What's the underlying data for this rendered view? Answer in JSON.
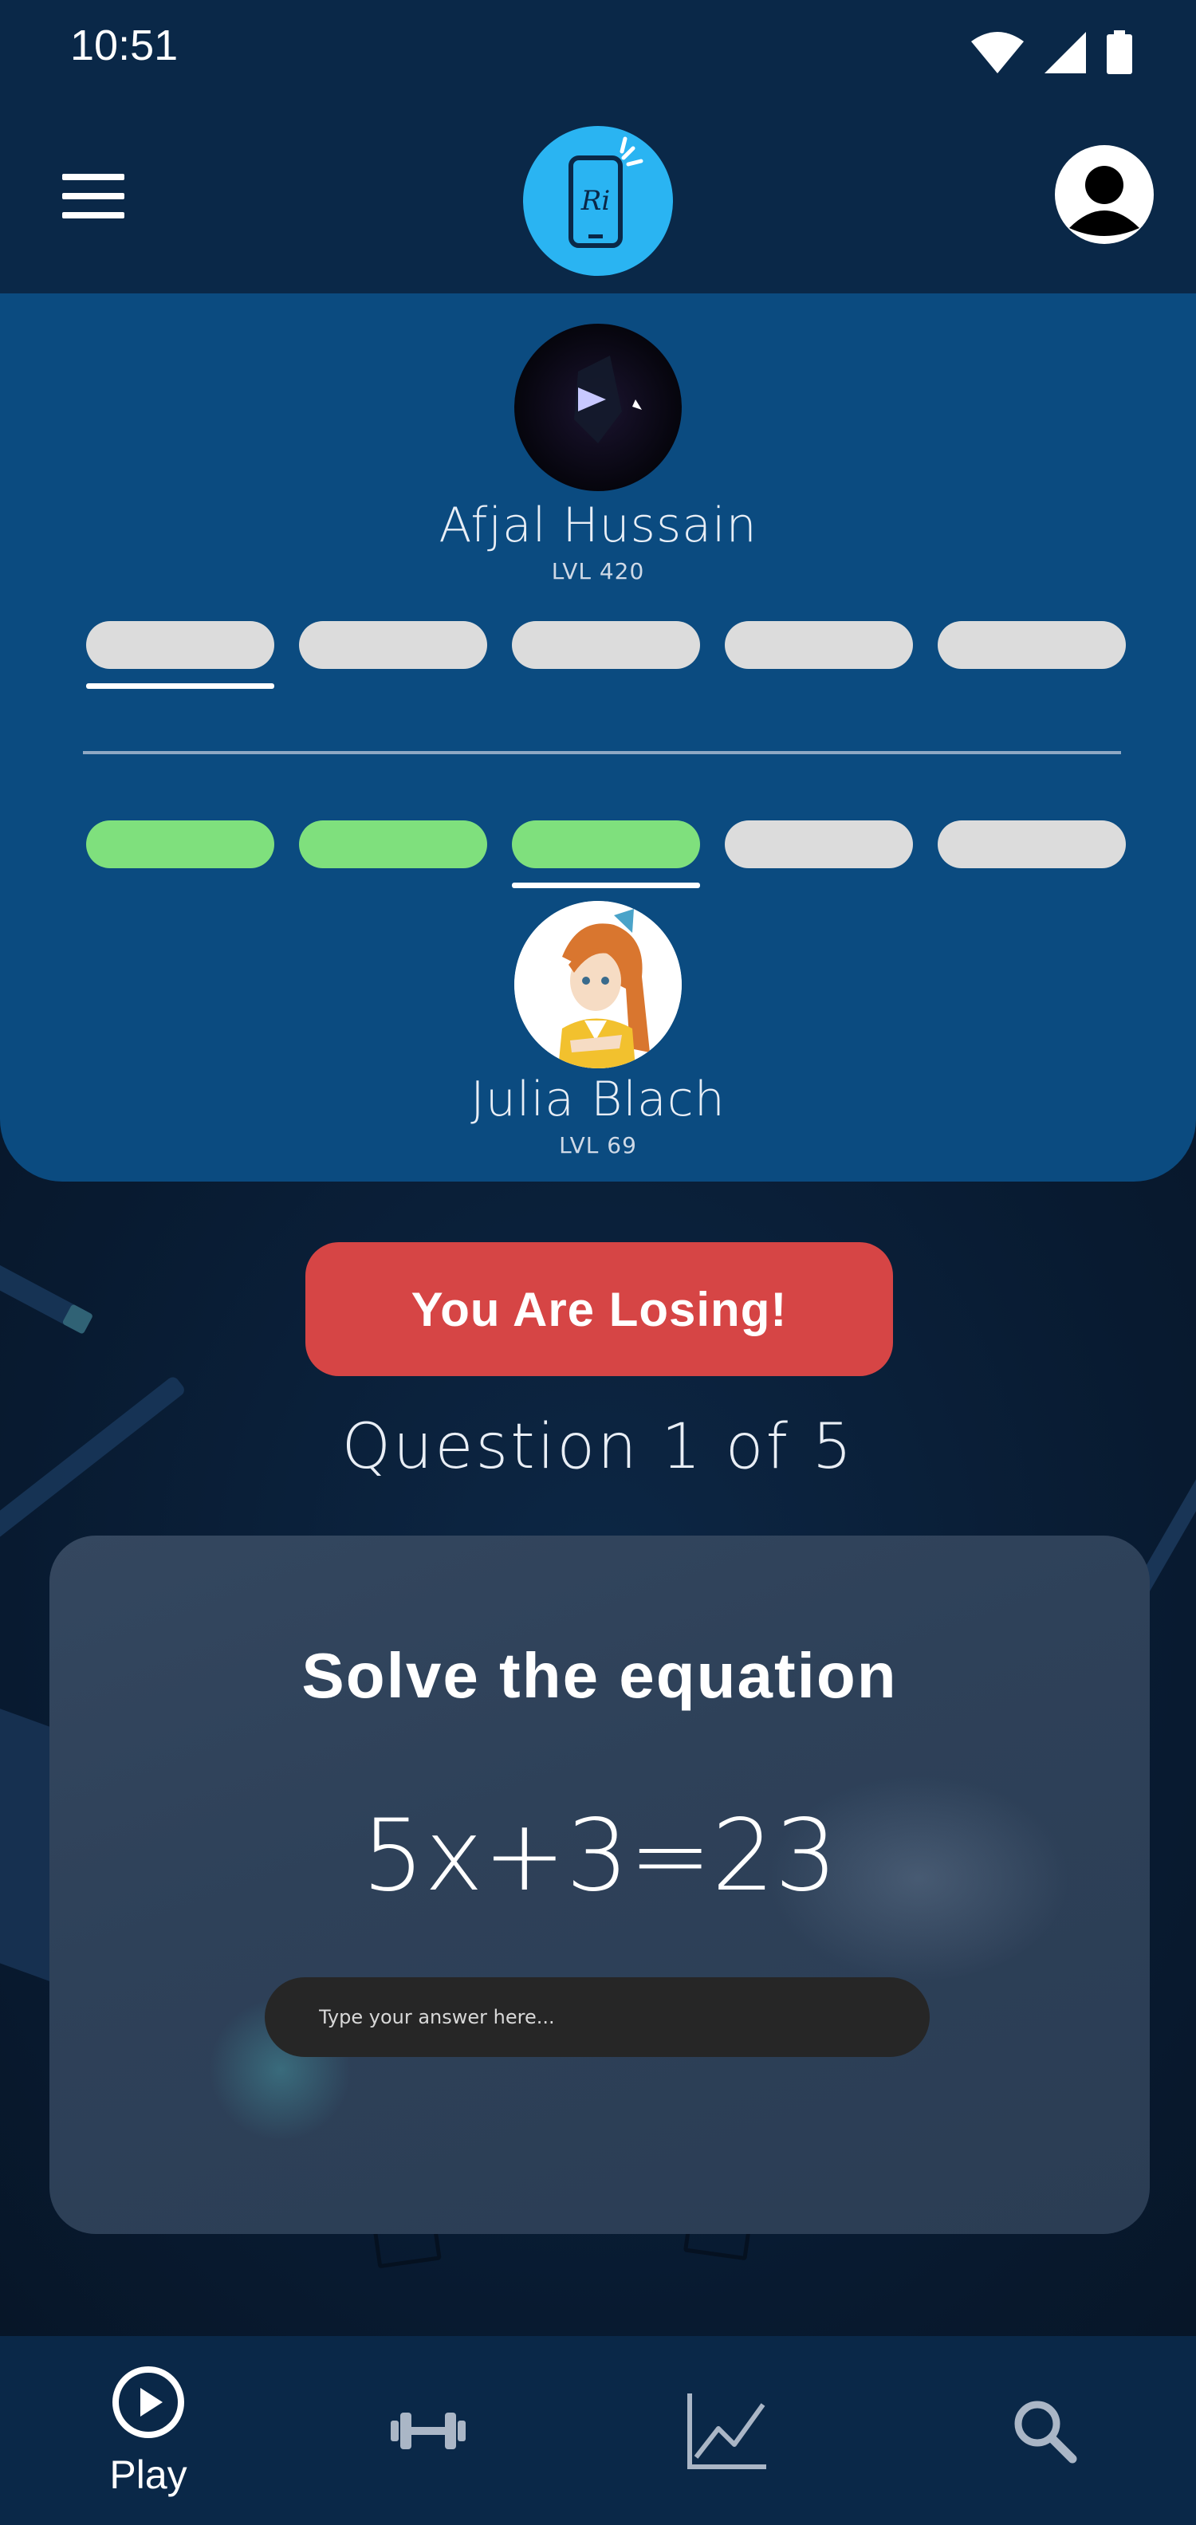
{
  "status_bar": {
    "time": "10:51"
  },
  "app_bar": {
    "logo_icon": "phone-logo-icon",
    "menu_icon": "hamburger-menu-icon",
    "profile_icon": "profile-avatar-icon"
  },
  "match": {
    "opponent": {
      "name": "Afjal Hussain",
      "level": "LVL 420",
      "progress": [
        false,
        false,
        false,
        false,
        false
      ],
      "current_index": 0
    },
    "player": {
      "name": "Julia Blach",
      "level": "LVL 69",
      "progress": [
        true,
        true,
        true,
        false,
        false
      ],
      "current_index": 2
    }
  },
  "status_button": {
    "label": "You Are Losing!"
  },
  "question": {
    "counter": "Question 1 of 5",
    "title": "Solve the equation",
    "equation": "5x+3=23",
    "answer_placeholder": "Type your answer here..."
  },
  "bottom_nav": {
    "items": [
      {
        "label": "Play",
        "icon": "play-icon",
        "active": true
      },
      {
        "label": "",
        "icon": "dumbbell-icon",
        "active": false
      },
      {
        "label": "",
        "icon": "chart-icon",
        "active": false
      },
      {
        "label": "",
        "icon": "search-icon",
        "active": false
      }
    ]
  },
  "colors": {
    "background": "#0a1f38",
    "header": "#0a2848",
    "panel": "#0b4b80",
    "pill_empty": "#dcdcdc",
    "pill_done": "#7fe07d",
    "losing": "#d64545",
    "logo": "#2ab4f2",
    "card": "#2e4159",
    "input": "#262626"
  }
}
